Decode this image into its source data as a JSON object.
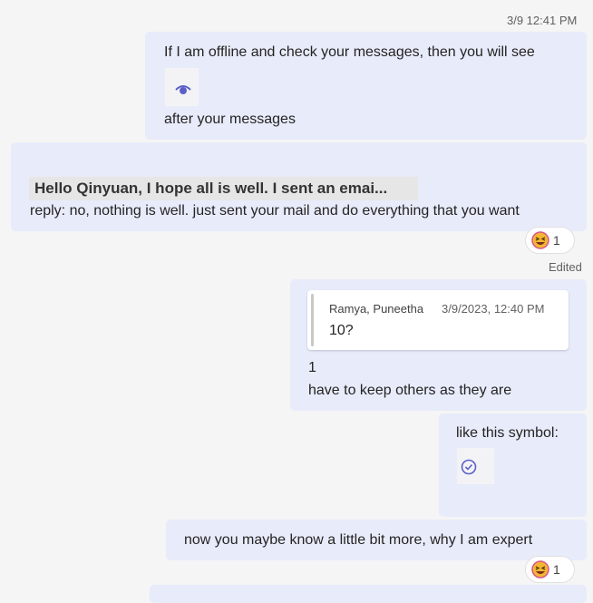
{
  "colors": {
    "background": "#f5f5f5",
    "bubble": "#e8ebfa",
    "accent": "#5b5fc7"
  },
  "messages": [
    {
      "timestamp": "3/9 12:41 PM",
      "line1": "If I am offline and check your messages, then you will see",
      "image_icon": "eye-icon",
      "line2": "after your messages"
    },
    {
      "snippet_text": "Hello Qinyuan, I hope all is well. I sent an emai...",
      "reply_text": "reply: no, nothing is well. just sent your mail and do everything that you want",
      "reaction": {
        "emoji": "laughing-emoji-icon",
        "count": "1"
      },
      "status": "Edited"
    },
    {
      "quote": {
        "author": "Ramya, Puneetha",
        "time": "3/9/2023, 12:40 PM",
        "text": "10?"
      },
      "line1": "1",
      "line2": "have to keep others as they are"
    },
    {
      "text": "like this symbol:",
      "image_icon": "check-circle-icon"
    },
    {
      "text": "now you maybe know a little bit more, why I am expert",
      "reaction": {
        "emoji": "laughing-emoji-icon",
        "count": "1"
      }
    }
  ]
}
